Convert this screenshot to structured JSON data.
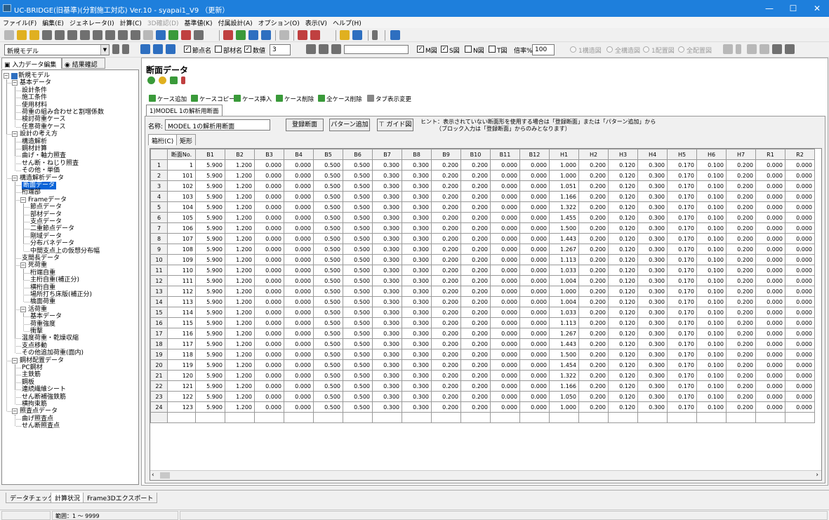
{
  "window": {
    "title": "UC-BRIDGE(旧基準)(分割施工対応) Ver.10 - syapai1_V9 （更新）",
    "minimize": "—",
    "maximize": "☐",
    "close": "✕"
  },
  "menu": [
    {
      "label": "ファイル(F)",
      "enabled": true
    },
    {
      "label": "編集(E)",
      "enabled": true
    },
    {
      "label": "ジェネレータ(I)",
      "enabled": true
    },
    {
      "label": "計算(C)",
      "enabled": true
    },
    {
      "label": "3D確認(D)",
      "enabled": false
    },
    {
      "label": "基準値(K)",
      "enabled": true
    },
    {
      "label": "付属設計(A)",
      "enabled": true
    },
    {
      "label": "オプション(O)",
      "enabled": true
    },
    {
      "label": "表示(V)",
      "enabled": true
    },
    {
      "label": "ヘルプ(H)",
      "enabled": true
    }
  ],
  "toolbar2": {
    "model_select": "新規モデル",
    "chk_node_name": "節点名",
    "chk_member_name": "部材名",
    "chk_value": "数値",
    "value_digits": "3",
    "chk_m": "M図",
    "chk_s": "S図",
    "chk_n": "N図",
    "chk_t": "T図",
    "zoom_label": "倍率%",
    "zoom_value": "100",
    "radio_1": "1構造図",
    "radio_2": "全構造図",
    "radio_3": "1配置図",
    "radio_4": "全配置図"
  },
  "left_tabs": {
    "input_tab": "入力データ編集",
    "result_tab": "結果確認"
  },
  "tree": [
    {
      "label": "新規モデル",
      "level": 0
    },
    {
      "label": "基本データ",
      "level": 1
    },
    {
      "label": "設計条件",
      "level": 2
    },
    {
      "label": "施工条件",
      "level": 2
    },
    {
      "label": "使用材料",
      "level": 2
    },
    {
      "label": "荷重の組み合わせと割増係数",
      "level": 2
    },
    {
      "label": "検討荷重ケース",
      "level": 2
    },
    {
      "label": "任意荷重ケース",
      "level": 2
    },
    {
      "label": "設計の考え方",
      "level": 1
    },
    {
      "label": "構造解析",
      "level": 2
    },
    {
      "label": "鋼材計算",
      "level": 2
    },
    {
      "label": "曲げ・軸力照査",
      "level": 2
    },
    {
      "label": "せん断・ねじり照査",
      "level": 2
    },
    {
      "label": "その他・単価",
      "level": 2
    },
    {
      "label": "構造解析データ",
      "level": 1
    },
    {
      "label": "断面データ",
      "level": 2,
      "selected": true
    },
    {
      "label": "桁端部",
      "level": 2
    },
    {
      "label": "Frameデータ",
      "level": 2
    },
    {
      "label": "節点データ",
      "level": 3
    },
    {
      "label": "部材データ",
      "level": 3
    },
    {
      "label": "支点データ",
      "level": 3
    },
    {
      "label": "二重節点データ",
      "level": 3
    },
    {
      "label": "剛域データ",
      "level": 3
    },
    {
      "label": "分布バネデータ",
      "level": 3
    },
    {
      "label": "中間支点上の仮想分布幅",
      "level": 3
    },
    {
      "label": "支間長データ",
      "level": 2
    },
    {
      "label": "死荷重",
      "level": 2
    },
    {
      "label": "桁端自重",
      "level": 3
    },
    {
      "label": "主桁自重(補正分)",
      "level": 3
    },
    {
      "label": "横桁自重",
      "level": 3
    },
    {
      "label": "場所打ち床版(補正分)",
      "level": 3
    },
    {
      "label": "橋面荷重",
      "level": 3
    },
    {
      "label": "活荷重",
      "level": 2
    },
    {
      "label": "基本データ",
      "level": 3
    },
    {
      "label": "荷重強度",
      "level": 3
    },
    {
      "label": "衝撃",
      "level": 3
    },
    {
      "label": "温度荷重・乾燥収縮",
      "level": 2
    },
    {
      "label": "支点移動",
      "level": 2
    },
    {
      "label": "その他追加荷重(面内)",
      "level": 2
    },
    {
      "label": "鋼材配置データ",
      "level": 1
    },
    {
      "label": "PC鋼材",
      "level": 2
    },
    {
      "label": "主鉄筋",
      "level": 2
    },
    {
      "label": "鋼板",
      "level": 2
    },
    {
      "label": "連続繊維シート",
      "level": 2
    },
    {
      "label": "せん断補強鉄筋",
      "level": 2
    },
    {
      "label": "横拘束筋",
      "level": 2
    },
    {
      "label": "照査点データ",
      "level": 1
    },
    {
      "label": "曲げ照査点",
      "level": 2
    },
    {
      "label": "せん断照査点",
      "level": 2
    }
  ],
  "main": {
    "title": "断面データ",
    "case_buttons": [
      "ケース追加",
      "ケースコピー",
      "ケース挿入",
      "ケース削除",
      "全ケース削除",
      "タブ表示変更"
    ],
    "case_tab": "1)MODEL 1の解析用断面",
    "name_label": "名称:",
    "name_value": "MODEL 1の解析用断面",
    "register_button": "登録断面",
    "pattern_button": "パターン追加",
    "guide_button": "ガイド図",
    "hint_line1": "ヒント：表示されていない断面形を使用する場合は「登録断面」または「パターン追加」から",
    "hint_line2": "（ブロック入力は「登録断面」からのみとなります）",
    "sub_tabs": [
      "箱桁(C)",
      "矩形"
    ]
  },
  "table": {
    "columns": [
      "断面No.",
      "B1",
      "B2",
      "B3",
      "B4",
      "B5",
      "B6",
      "B7",
      "B8",
      "B9",
      "B10",
      "B11",
      "B12",
      "H1",
      "H2",
      "H3",
      "H4",
      "H5",
      "H6",
      "H7",
      "R1",
      "R2"
    ],
    "rows": [
      [
        "1",
        "1",
        "5.900",
        "1.200",
        "0.000",
        "0.000",
        "0.500",
        "0.500",
        "0.300",
        "0.300",
        "0.200",
        "0.200",
        "0.000",
        "0.000",
        "1.000",
        "0.200",
        "0.120",
        "0.300",
        "0.170",
        "0.100",
        "0.200",
        "0.000",
        "0.000"
      ],
      [
        "2",
        "101",
        "5.900",
        "1.200",
        "0.000",
        "0.000",
        "0.500",
        "0.500",
        "0.300",
        "0.300",
        "0.200",
        "0.200",
        "0.000",
        "0.000",
        "1.000",
        "0.200",
        "0.120",
        "0.300",
        "0.170",
        "0.100",
        "0.200",
        "0.000",
        "0.000"
      ],
      [
        "3",
        "102",
        "5.900",
        "1.200",
        "0.000",
        "0.000",
        "0.500",
        "0.500",
        "0.300",
        "0.300",
        "0.200",
        "0.200",
        "0.000",
        "0.000",
        "1.051",
        "0.200",
        "0.120",
        "0.300",
        "0.170",
        "0.100",
        "0.200",
        "0.000",
        "0.000"
      ],
      [
        "4",
        "103",
        "5.900",
        "1.200",
        "0.000",
        "0.000",
        "0.500",
        "0.500",
        "0.300",
        "0.300",
        "0.200",
        "0.200",
        "0.000",
        "0.000",
        "1.166",
        "0.200",
        "0.120",
        "0.300",
        "0.170",
        "0.100",
        "0.200",
        "0.000",
        "0.000"
      ],
      [
        "5",
        "104",
        "5.900",
        "1.200",
        "0.000",
        "0.000",
        "0.500",
        "0.500",
        "0.300",
        "0.300",
        "0.200",
        "0.200",
        "0.000",
        "0.000",
        "1.322",
        "0.200",
        "0.120",
        "0.300",
        "0.170",
        "0.100",
        "0.200",
        "0.000",
        "0.000"
      ],
      [
        "6",
        "105",
        "5.900",
        "1.200",
        "0.000",
        "0.000",
        "0.500",
        "0.500",
        "0.300",
        "0.300",
        "0.200",
        "0.200",
        "0.000",
        "0.000",
        "1.455",
        "0.200",
        "0.120",
        "0.300",
        "0.170",
        "0.100",
        "0.200",
        "0.000",
        "0.000"
      ],
      [
        "7",
        "106",
        "5.900",
        "1.200",
        "0.000",
        "0.000",
        "0.500",
        "0.500",
        "0.300",
        "0.300",
        "0.200",
        "0.200",
        "0.000",
        "0.000",
        "1.500",
        "0.200",
        "0.120",
        "0.300",
        "0.170",
        "0.100",
        "0.200",
        "0.000",
        "0.000"
      ],
      [
        "8",
        "107",
        "5.900",
        "1.200",
        "0.000",
        "0.000",
        "0.500",
        "0.500",
        "0.300",
        "0.300",
        "0.200",
        "0.200",
        "0.000",
        "0.000",
        "1.443",
        "0.200",
        "0.120",
        "0.300",
        "0.170",
        "0.100",
        "0.200",
        "0.000",
        "0.000"
      ],
      [
        "9",
        "108",
        "5.900",
        "1.200",
        "0.000",
        "0.000",
        "0.500",
        "0.500",
        "0.300",
        "0.300",
        "0.200",
        "0.200",
        "0.000",
        "0.000",
        "1.267",
        "0.200",
        "0.120",
        "0.300",
        "0.170",
        "0.100",
        "0.200",
        "0.000",
        "0.000"
      ],
      [
        "10",
        "109",
        "5.900",
        "1.200",
        "0.000",
        "0.000",
        "0.500",
        "0.500",
        "0.300",
        "0.300",
        "0.200",
        "0.200",
        "0.000",
        "0.000",
        "1.113",
        "0.200",
        "0.120",
        "0.300",
        "0.170",
        "0.100",
        "0.200",
        "0.000",
        "0.000"
      ],
      [
        "11",
        "110",
        "5.900",
        "1.200",
        "0.000",
        "0.000",
        "0.500",
        "0.500",
        "0.300",
        "0.300",
        "0.200",
        "0.200",
        "0.000",
        "0.000",
        "1.033",
        "0.200",
        "0.120",
        "0.300",
        "0.170",
        "0.100",
        "0.200",
        "0.000",
        "0.000"
      ],
      [
        "12",
        "111",
        "5.900",
        "1.200",
        "0.000",
        "0.000",
        "0.500",
        "0.500",
        "0.300",
        "0.300",
        "0.200",
        "0.200",
        "0.000",
        "0.000",
        "1.004",
        "0.200",
        "0.120",
        "0.300",
        "0.170",
        "0.100",
        "0.200",
        "0.000",
        "0.000"
      ],
      [
        "13",
        "112",
        "5.900",
        "1.200",
        "0.000",
        "0.000",
        "0.500",
        "0.500",
        "0.300",
        "0.300",
        "0.200",
        "0.200",
        "0.000",
        "0.000",
        "1.000",
        "0.200",
        "0.120",
        "0.300",
        "0.170",
        "0.100",
        "0.200",
        "0.000",
        "0.000"
      ],
      [
        "14",
        "113",
        "5.900",
        "1.200",
        "0.000",
        "0.000",
        "0.500",
        "0.500",
        "0.300",
        "0.300",
        "0.200",
        "0.200",
        "0.000",
        "0.000",
        "1.004",
        "0.200",
        "0.120",
        "0.300",
        "0.170",
        "0.100",
        "0.200",
        "0.000",
        "0.000"
      ],
      [
        "15",
        "114",
        "5.900",
        "1.200",
        "0.000",
        "0.000",
        "0.500",
        "0.500",
        "0.300",
        "0.300",
        "0.200",
        "0.200",
        "0.000",
        "0.000",
        "1.033",
        "0.200",
        "0.120",
        "0.300",
        "0.170",
        "0.100",
        "0.200",
        "0.000",
        "0.000"
      ],
      [
        "16",
        "115",
        "5.900",
        "1.200",
        "0.000",
        "0.000",
        "0.500",
        "0.500",
        "0.300",
        "0.300",
        "0.200",
        "0.200",
        "0.000",
        "0.000",
        "1.113",
        "0.200",
        "0.120",
        "0.300",
        "0.170",
        "0.100",
        "0.200",
        "0.000",
        "0.000"
      ],
      [
        "17",
        "116",
        "5.900",
        "1.200",
        "0.000",
        "0.000",
        "0.500",
        "0.500",
        "0.300",
        "0.300",
        "0.200",
        "0.200",
        "0.000",
        "0.000",
        "1.267",
        "0.200",
        "0.120",
        "0.300",
        "0.170",
        "0.100",
        "0.200",
        "0.000",
        "0.000"
      ],
      [
        "18",
        "117",
        "5.900",
        "1.200",
        "0.000",
        "0.000",
        "0.500",
        "0.500",
        "0.300",
        "0.300",
        "0.200",
        "0.200",
        "0.000",
        "0.000",
        "1.443",
        "0.200",
        "0.120",
        "0.300",
        "0.170",
        "0.100",
        "0.200",
        "0.000",
        "0.000"
      ],
      [
        "19",
        "118",
        "5.900",
        "1.200",
        "0.000",
        "0.000",
        "0.500",
        "0.500",
        "0.300",
        "0.300",
        "0.200",
        "0.200",
        "0.000",
        "0.000",
        "1.500",
        "0.200",
        "0.120",
        "0.300",
        "0.170",
        "0.100",
        "0.200",
        "0.000",
        "0.000"
      ],
      [
        "20",
        "119",
        "5.900",
        "1.200",
        "0.000",
        "0.000",
        "0.500",
        "0.500",
        "0.300",
        "0.300",
        "0.200",
        "0.200",
        "0.000",
        "0.000",
        "1.454",
        "0.200",
        "0.120",
        "0.300",
        "0.170",
        "0.100",
        "0.200",
        "0.000",
        "0.000"
      ],
      [
        "21",
        "120",
        "5.900",
        "1.200",
        "0.000",
        "0.000",
        "0.500",
        "0.500",
        "0.300",
        "0.300",
        "0.200",
        "0.200",
        "0.000",
        "0.000",
        "1.322",
        "0.200",
        "0.120",
        "0.300",
        "0.170",
        "0.100",
        "0.200",
        "0.000",
        "0.000"
      ],
      [
        "22",
        "121",
        "5.900",
        "1.200",
        "0.000",
        "0.000",
        "0.500",
        "0.500",
        "0.300",
        "0.300",
        "0.200",
        "0.200",
        "0.000",
        "0.000",
        "1.166",
        "0.200",
        "0.120",
        "0.300",
        "0.170",
        "0.100",
        "0.200",
        "0.000",
        "0.000"
      ],
      [
        "23",
        "122",
        "5.900",
        "1.200",
        "0.000",
        "0.000",
        "0.500",
        "0.500",
        "0.300",
        "0.300",
        "0.200",
        "0.200",
        "0.000",
        "0.000",
        "1.050",
        "0.200",
        "0.120",
        "0.300",
        "0.170",
        "0.100",
        "0.200",
        "0.000",
        "0.000"
      ],
      [
        "24",
        "123",
        "5.900",
        "1.200",
        "0.000",
        "0.000",
        "0.500",
        "0.500",
        "0.300",
        "0.300",
        "0.200",
        "0.200",
        "0.000",
        "0.000",
        "1.000",
        "0.200",
        "0.120",
        "0.300",
        "0.170",
        "0.100",
        "0.200",
        "0.000",
        "0.000"
      ]
    ]
  },
  "bottom_tabs": [
    "データチェック",
    "計算状況",
    "Frame3Dエクスポート"
  ],
  "status": {
    "range": "範囲：1 ～ 9999"
  },
  "colors": {
    "titlebar": "#1e7fdc",
    "selection": "#0a64d8"
  }
}
